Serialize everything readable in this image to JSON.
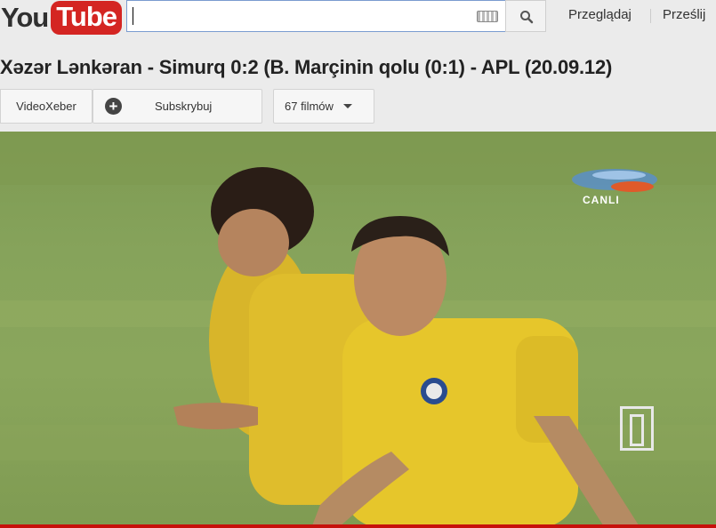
{
  "header": {
    "logo_you": "You",
    "logo_tube": "Tube",
    "search_value": "",
    "nav_browse": "Przeglądaj",
    "nav_upload": "Prześlij"
  },
  "video": {
    "title": "Xəzər Lənkəran - Simurq 0:2 (B. Marçinin qolu (0:1) - APL (20.09.12)",
    "overlay_text": "CANLI"
  },
  "channel_bar": {
    "channel_name": "VideoXeber",
    "subscribe_label": "Subskrybuj",
    "videos_label": "67 filmów"
  },
  "colors": {
    "brand_red": "#d42522",
    "jersey_yellow": "#e6c62b",
    "pitch_green": "#86a35b"
  },
  "icons": [
    "keyboard-icon",
    "search-icon",
    "plus-icon",
    "chevron-down-icon",
    "pause-icon"
  ]
}
